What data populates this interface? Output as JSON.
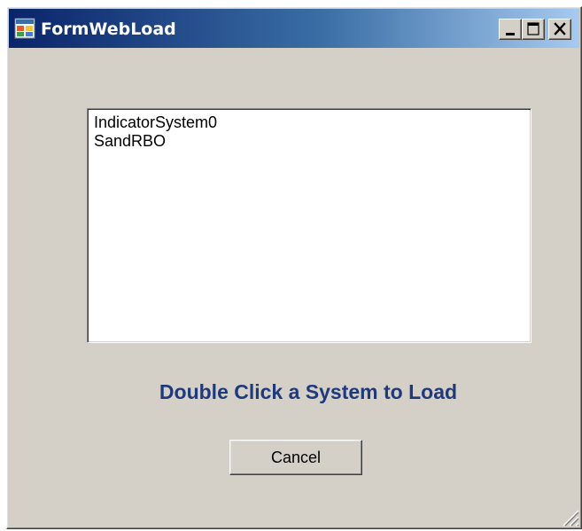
{
  "window": {
    "title": "FormWebLoad",
    "icon": "app-icon",
    "controls": {
      "minimize": "minimize-icon",
      "maximize": "maximize-icon",
      "close": "close-icon"
    }
  },
  "systems_list": {
    "items": [
      "IndicatorSystem0",
      "SandRBO"
    ]
  },
  "instruction_text": "Double Click a System to Load",
  "cancel_label": "Cancel",
  "colors": {
    "dialog_face": "#d4d0c8",
    "title_gradient_start": "#0a246a",
    "title_gradient_end": "#a6caf0",
    "instruction_text": "#1f3a7a",
    "list_background": "#ffffff"
  }
}
